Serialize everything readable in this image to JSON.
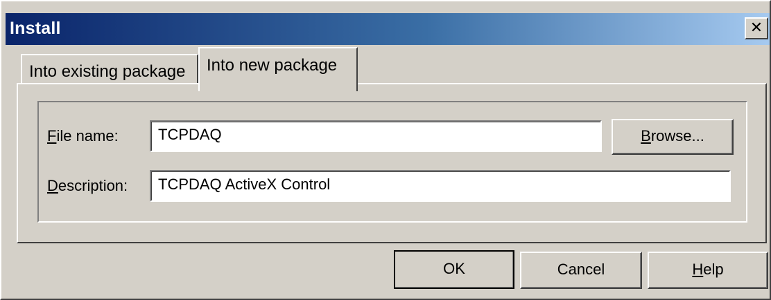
{
  "window": {
    "title": "Install",
    "close_glyph": "✕"
  },
  "tabs": [
    {
      "label": "Into existing package",
      "selected": false
    },
    {
      "label": "Into new package",
      "selected": true
    }
  ],
  "form": {
    "file_name": {
      "label_accel": "F",
      "label_rest": "ile name:",
      "value": "TCPDAQ"
    },
    "description": {
      "label_accel": "D",
      "label_rest": "escription:",
      "value": "TCPDAQ ActiveX Control"
    },
    "browse": {
      "accel": "B",
      "rest": "rowse..."
    }
  },
  "buttons": {
    "ok": "OK",
    "cancel": "Cancel",
    "help_accel": "H",
    "help_rest": "elp"
  },
  "colors": {
    "face": "#d4d0c8",
    "title_start": "#0a246a",
    "title_end": "#a6caf0"
  },
  "icons": {
    "close": "close-icon"
  }
}
